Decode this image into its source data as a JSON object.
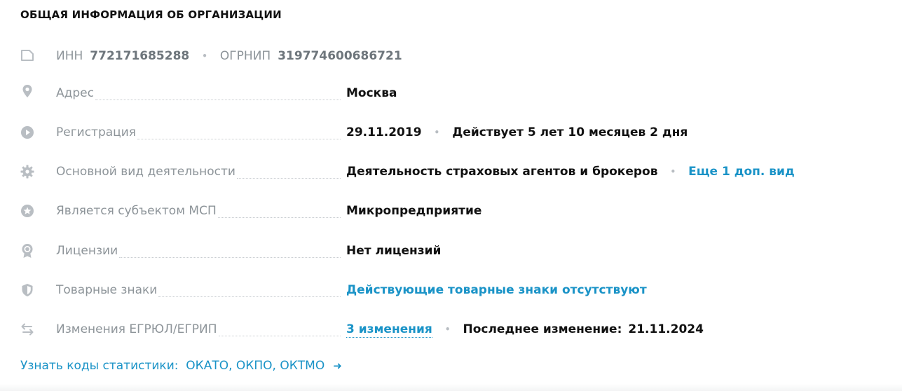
{
  "section_title": "ОБЩАЯ ИНФОРМАЦИЯ ОБ ОРГАНИЗАЦИИ",
  "ids": {
    "inn_label": "ИНН",
    "inn_value": "772171685288",
    "ogrnip_label": "ОГРНИП",
    "ogrnip_value": "319774600686721",
    "icon": "card-icon"
  },
  "rows": [
    {
      "icon": "location-pin-icon",
      "label": "Адрес",
      "value": "Москва"
    },
    {
      "icon": "play-circle-icon",
      "label": "Регистрация",
      "value": "29.11.2019",
      "extra": "Действует 5 лет 10 месяцев 2 дня"
    },
    {
      "icon": "gear-icon",
      "label": "Основной вид деятельности",
      "value": "Деятельность страховых агентов и брокеров",
      "extra_link": "Еще 1 доп. вид"
    },
    {
      "icon": "star-circle-icon",
      "label": "Является субъектом МСП",
      "value": "Микропредприятие"
    },
    {
      "icon": "award-icon",
      "label": "Лицензии",
      "value": "Нет лицензий"
    },
    {
      "icon": "shield-icon",
      "label": "Товарные знаки",
      "value_link": "Действующие товарные знаки отсутствуют"
    },
    {
      "icon": "swap-arrows-icon",
      "label": "Изменения ЕГРЮЛ/ЕГРИП",
      "value_link": "3 изменения",
      "extra_label": "Последнее изменение:",
      "extra_value": "21.11.2024"
    }
  ],
  "statistics_link": "Узнать коды статистики:  ОКАТО, ОКПО, ОКТМО",
  "colors": {
    "icon": "#b9bec3",
    "label": "#8d9499",
    "link": "#1a93c7",
    "text": "#111111"
  }
}
